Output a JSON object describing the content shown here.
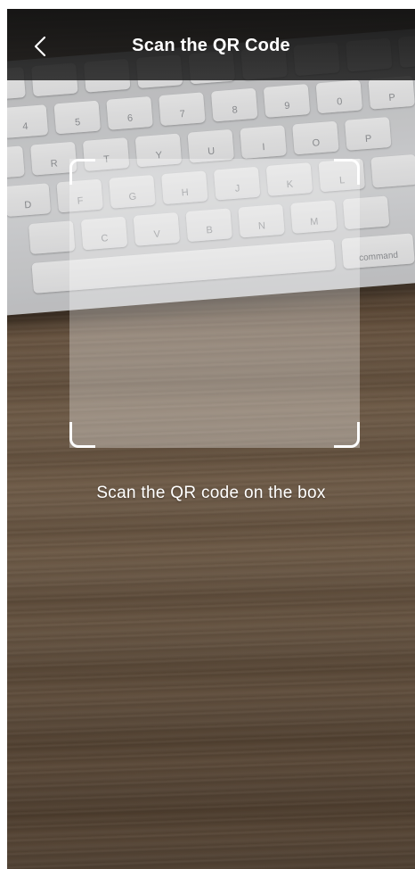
{
  "header": {
    "title": "Scan the QR Code",
    "back_icon": "chevron-left-icon"
  },
  "scanner": {
    "instruction": "Scan the QR code on the box"
  },
  "camera_feed": {
    "keyboard_keys": {
      "row1": [
        "",
        "",
        "",
        "",
        "",
        "",
        "",
        ""
      ],
      "row2": [
        "4",
        "5",
        "6",
        "7",
        "8",
        "9",
        "0",
        "P"
      ],
      "row3": [
        "R",
        "T",
        "Y",
        "U",
        "I",
        "O",
        "P"
      ],
      "row4": [
        "D",
        "F",
        "G",
        "H",
        "J",
        "K",
        "L"
      ],
      "row5": [
        "C",
        "V",
        "B",
        "N",
        "M"
      ],
      "command_label": "command"
    }
  },
  "colors": {
    "topbar": "#1e1e1e",
    "frame_corner": "#ffffff",
    "frame_fill": "rgba(255,255,255,0.32)"
  }
}
